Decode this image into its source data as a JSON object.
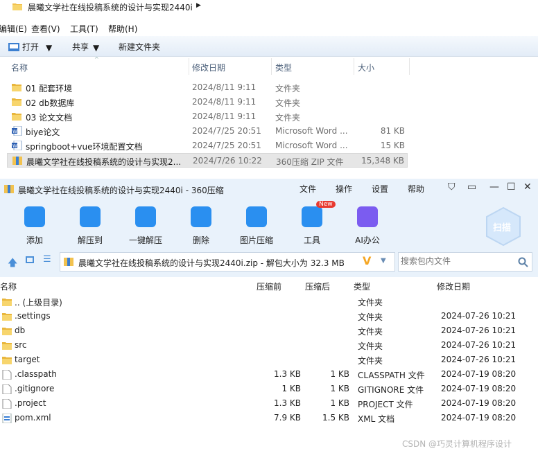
{
  "explorer": {
    "breadcrumb": "晨曦文学社在线投稿系统的设计与实现2440i",
    "menu": [
      "编辑(E)",
      "查看(V)",
      "工具(T)",
      "帮助(H)"
    ],
    "toolbar": {
      "open": "打开",
      "share": "共享",
      "new_folder": "新建文件夹"
    },
    "columns": {
      "name": "名称",
      "date": "修改日期",
      "type": "类型",
      "size": "大小"
    },
    "files": [
      {
        "name": "01 配套环境",
        "date": "2024/8/11 9:11",
        "type": "文件夹",
        "size": "",
        "icon": "folder-icon"
      },
      {
        "name": "02 db数据库",
        "date": "2024/8/11 9:11",
        "type": "文件夹",
        "size": "",
        "icon": "folder-icon"
      },
      {
        "name": "03 论文文档",
        "date": "2024/8/11 9:11",
        "type": "文件夹",
        "size": "",
        "icon": "folder-icon"
      },
      {
        "name": "biye论文",
        "date": "2024/7/25 20:51",
        "type": "Microsoft Word ...",
        "size": "81 KB",
        "icon": "word-doc-icon"
      },
      {
        "name": "springboot+vue环境配置文档",
        "date": "2024/7/25 20:51",
        "type": "Microsoft Word ...",
        "size": "15 KB",
        "icon": "word-doc-icon"
      },
      {
        "name": "晨曦文学社在线投稿系统的设计与实现2...",
        "date": "2024/7/26 10:22",
        "type": "360压缩 ZIP 文件",
        "size": "15,348 KB",
        "icon": "zip-archive-icon",
        "selected": true
      }
    ]
  },
  "zip360": {
    "title": "晨曦文学社在线投稿系统的设计与实现2440i - 360压缩",
    "menu": [
      "文件",
      "操作",
      "设置",
      "帮助"
    ],
    "tools": [
      {
        "label": "添加",
        "icon": "add-icon",
        "color": "#2a8ff0"
      },
      {
        "label": "解压到",
        "icon": "extract-to-icon",
        "color": "#2a8ff0"
      },
      {
        "label": "一键解压",
        "icon": "one-click-extract-icon",
        "color": "#2a8ff0"
      },
      {
        "label": "删除",
        "icon": "trash-icon",
        "color": "#2a8ff0"
      },
      {
        "label": "图片压缩",
        "icon": "image-compress-icon",
        "color": "#2a8ff0"
      },
      {
        "label": "工具",
        "icon": "tools-icon",
        "color": "#2a8ff0",
        "badge": "New"
      },
      {
        "label": "AI办公",
        "icon": "ai-office-icon",
        "color": "#7b5cf0"
      }
    ],
    "scan_label": "扫描",
    "address": "晨曦文学社在线投稿系统的设计与实现2440i.zip - 解包大小为 32.3 MB",
    "search_placeholder": "搜索包内文件",
    "columns": {
      "name": "名称",
      "compressed_before": "压缩前",
      "compressed_after": "压缩后",
      "type": "类型",
      "date": "修改日期"
    },
    "entries": [
      {
        "name": ".. (上级目录)",
        "before": "",
        "after": "",
        "type": "文件夹",
        "date": "",
        "icon": "folder-icon"
      },
      {
        "name": ".settings",
        "before": "",
        "after": "",
        "type": "文件夹",
        "date": "2024-07-26 10:21",
        "icon": "folder-icon"
      },
      {
        "name": "db",
        "before": "",
        "after": "",
        "type": "文件夹",
        "date": "2024-07-26 10:21",
        "icon": "folder-icon"
      },
      {
        "name": "src",
        "before": "",
        "after": "",
        "type": "文件夹",
        "date": "2024-07-26 10:21",
        "icon": "folder-icon"
      },
      {
        "name": "target",
        "before": "",
        "after": "",
        "type": "文件夹",
        "date": "2024-07-26 10:21",
        "icon": "folder-icon"
      },
      {
        "name": ".classpath",
        "before": "1.3 KB",
        "after": "1 KB",
        "type": "CLASSPATH 文件",
        "date": "2024-07-19 08:20",
        "icon": "file-icon"
      },
      {
        "name": ".gitignore",
        "before": "1 KB",
        "after": "1 KB",
        "type": "GITIGNORE 文件",
        "date": "2024-07-19 08:20",
        "icon": "file-icon"
      },
      {
        "name": ".project",
        "before": "1.3 KB",
        "after": "1 KB",
        "type": "PROJECT 文件",
        "date": "2024-07-19 08:20",
        "icon": "file-icon"
      },
      {
        "name": "pom.xml",
        "before": "7.9 KB",
        "after": "1.5 KB",
        "type": "XML 文档",
        "date": "2024-07-19 08:20",
        "icon": "xml-file-icon"
      }
    ]
  },
  "watermark": "CSDN @巧灵计算机程序设计"
}
